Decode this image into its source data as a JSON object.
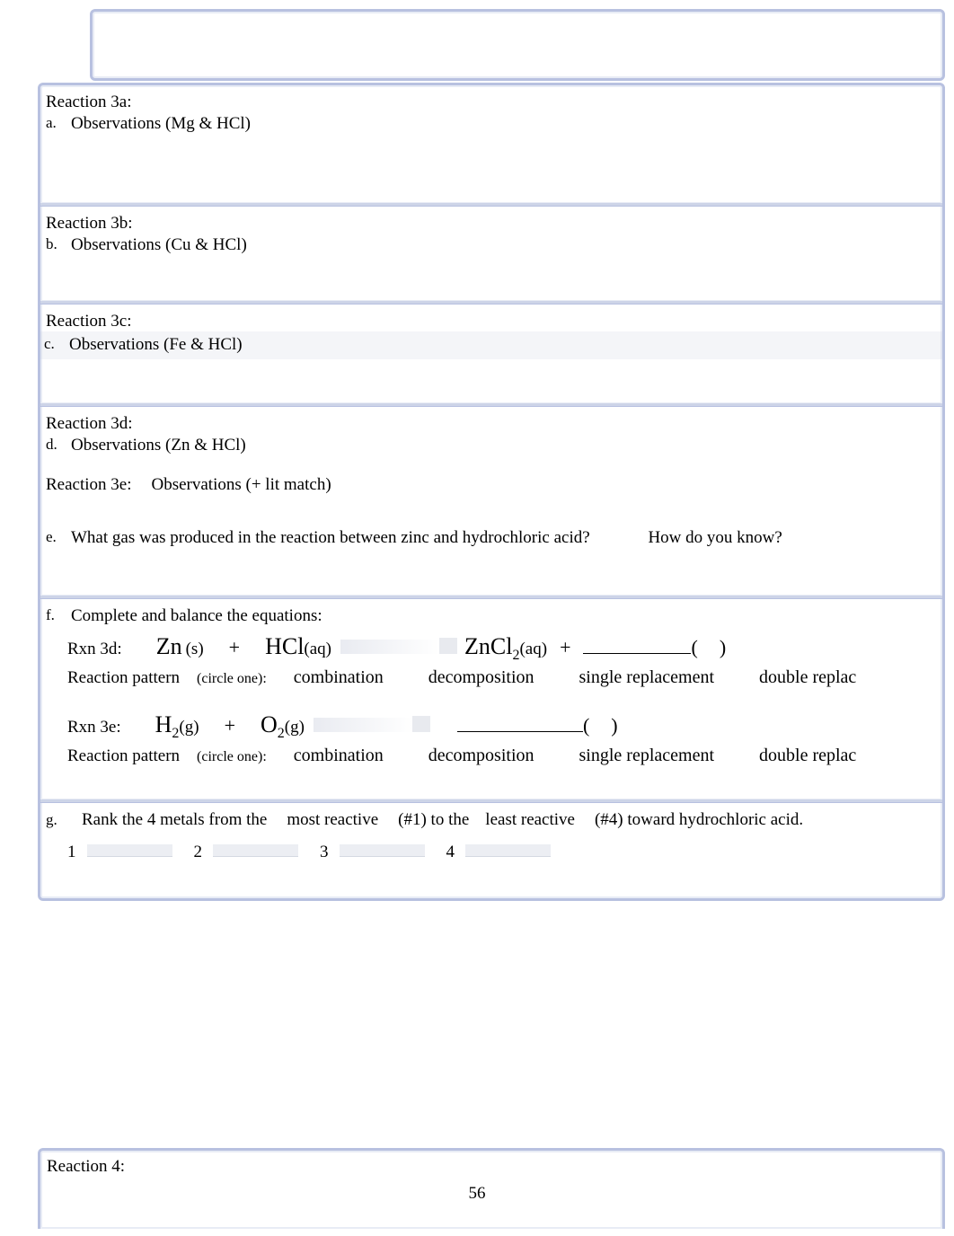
{
  "reactions": {
    "r3a": {
      "title": "Reaction 3a:",
      "marker": "a.",
      "obs": "Observations (Mg & HCl)"
    },
    "r3b": {
      "title": "Reaction 3b:",
      "marker": "b.",
      "obs": "Observations (Cu & HCl)"
    },
    "r3c": {
      "title": "Reaction 3c:",
      "marker": "c.",
      "obs": "Observations (Fe & HCl)"
    },
    "r3d": {
      "title": "Reaction 3d:",
      "marker": "d.",
      "obs": "Observations (Zn & HCl)"
    },
    "r3e": {
      "title": "Reaction 3e:",
      "obs": "Observations (+ lit match)"
    }
  },
  "q_e": {
    "marker": "e.",
    "text": "What gas was produced in the reaction between zinc and hydrochloric acid?",
    "extra": "How do you know?"
  },
  "q_f": {
    "marker": "f.",
    "text": "Complete and balance the equations:",
    "rxn3d_label": "Rxn 3d:",
    "rxn3d_r1": "Zn",
    "rxn3d_s1": "(s)",
    "plus": "+",
    "rxn3d_r2": "HCl",
    "rxn3d_s2": "(aq)",
    "rxn3d_p1": "ZnCl",
    "rxn3d_p1sub": "2",
    "rxn3d_p1s": "(aq)",
    "paren_open": "(",
    "paren_close": ")",
    "pattern_label": "Reaction pattern",
    "pattern_hint": "(circle one):",
    "opt1": "combination",
    "opt2": "decomposition",
    "opt3": "single replacement",
    "opt4": "double replac",
    "rxn3e_label": "Rxn 3e:",
    "rxn3e_r1": "H",
    "rxn3e_r1sub": "2",
    "rxn3e_r1s": "(g)",
    "rxn3e_r2": "O",
    "rxn3e_r2sub": "2",
    "rxn3e_r2s": "(g)"
  },
  "q_g": {
    "marker": "g.",
    "part1": "Rank the 4 metals from the",
    "part2": "most reactive",
    "part3": "(#1) to the",
    "part4": "least reactive",
    "part5": "(#4) toward hydrochloric acid.",
    "n1": "1",
    "n2": "2",
    "n3": "3",
    "n4": "4"
  },
  "r4": {
    "title": "Reaction 4:"
  },
  "page_number": "56"
}
